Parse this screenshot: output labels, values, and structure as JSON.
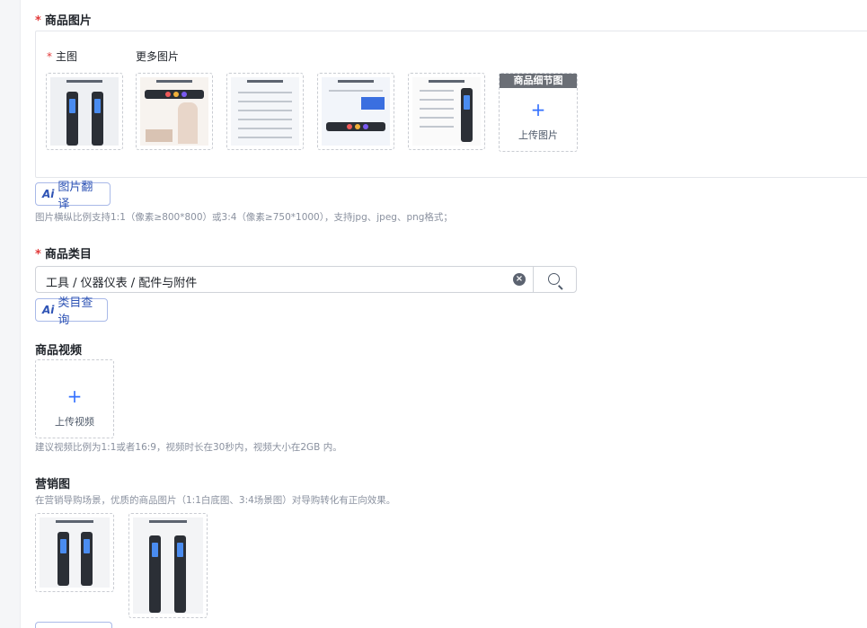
{
  "product_images": {
    "title": "商品图片",
    "main_label": "主图",
    "more_label": "更多图片",
    "detail_header": "商品细节图",
    "upload_label": "上传图片",
    "ai_translate_label": "图片翻译",
    "hint": "图片横纵比例支持1:1（像素≥800*800）或3:4（像素≥750*1000），支持jpg、jpeg、png格式；"
  },
  "category": {
    "title": "商品类目",
    "value": "工具 / 仪器仪表 / 配件与附件",
    "ai_query_label": "类目查询"
  },
  "video": {
    "title": "商品视频",
    "upload_label": "上传视频",
    "hint": "建议视频比例为1:1或者16:9，视频时长在30秒内，视频大小在2GB 内。"
  },
  "marketing": {
    "title": "营销图",
    "hint": "在营销导购场景，优质的商品图片（1:1白底图、3:4场景图）对导购转化有正向效果。"
  },
  "ai_badge": "Ai",
  "colors": {
    "accent": "#3370ff",
    "required": "#e23a3a",
    "ai_text": "#2f54b5"
  }
}
